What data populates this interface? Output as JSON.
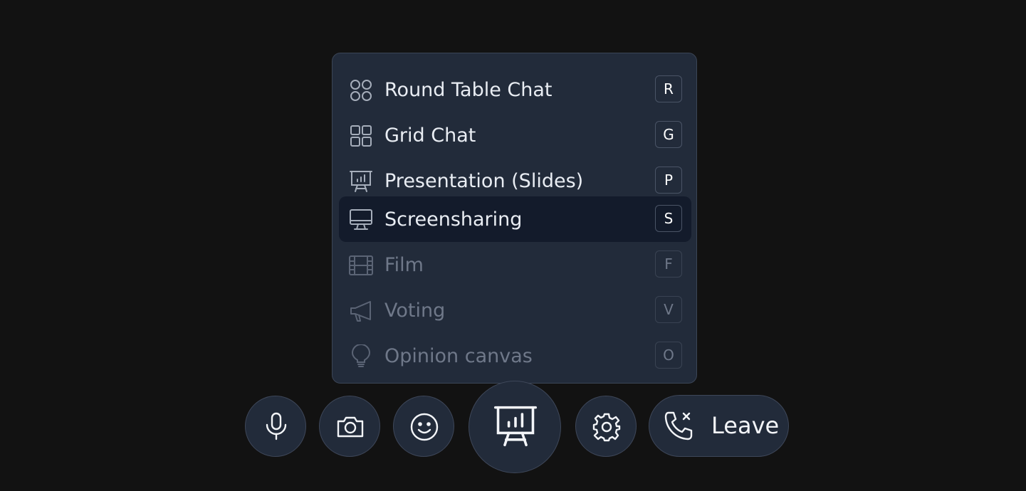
{
  "menu": {
    "items": [
      {
        "label": "Round Table Chat",
        "shortcut": "R",
        "icon": "round-table-icon",
        "state": "enabled"
      },
      {
        "label": "Grid Chat",
        "shortcut": "G",
        "icon": "grid-icon",
        "state": "enabled"
      },
      {
        "label": "Presentation (Slides)",
        "shortcut": "P",
        "icon": "presentation-icon",
        "state": "enabled"
      },
      {
        "label": "Screensharing",
        "shortcut": "S",
        "icon": "monitor-icon",
        "state": "selected"
      },
      {
        "label": "Film",
        "shortcut": "F",
        "icon": "film-icon",
        "state": "disabled"
      },
      {
        "label": "Voting",
        "shortcut": "V",
        "icon": "megaphone-icon",
        "state": "disabled"
      },
      {
        "label": "Opinion canvas",
        "shortcut": "O",
        "icon": "lightbulb-icon",
        "state": "disabled"
      }
    ]
  },
  "toolbar": {
    "buttons": [
      {
        "name": "microphone",
        "icon": "microphone-icon"
      },
      {
        "name": "camera",
        "icon": "camera-icon"
      },
      {
        "name": "reactions",
        "icon": "smiley-icon"
      },
      {
        "name": "mode-menu",
        "icon": "presentation-icon"
      },
      {
        "name": "settings",
        "icon": "gear-icon"
      }
    ],
    "leave_label": "Leave"
  },
  "colors": {
    "background": "#121212",
    "panel": "#222b3a",
    "selected_row": "#131b2b",
    "border": "#3b4556",
    "text": "#e9edf3",
    "muted_text": "#6f7889"
  }
}
